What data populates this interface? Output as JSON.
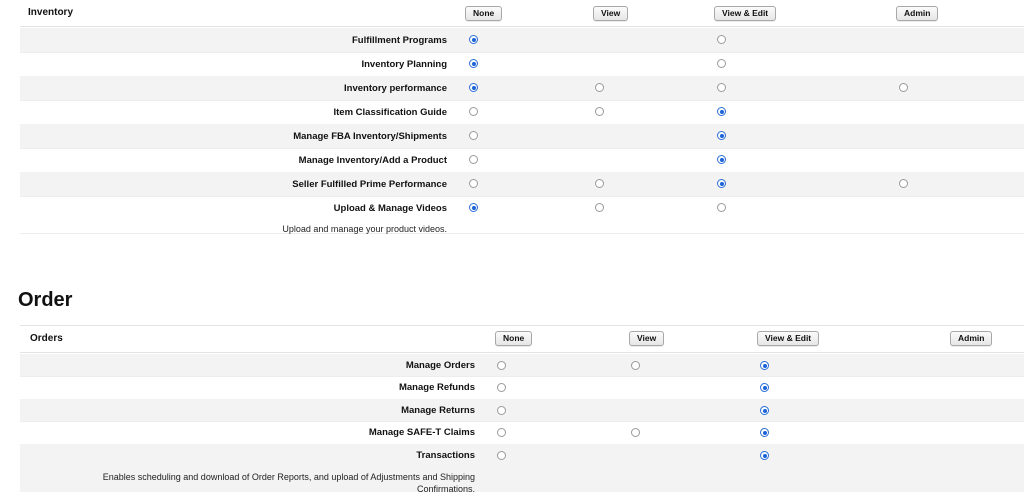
{
  "columns": [
    "None",
    "View",
    "View & Edit",
    "Admin"
  ],
  "inventory": {
    "title": "Inventory",
    "rows": [
      {
        "label": "Fulfillment Programs"
      },
      {
        "label": "Inventory Planning"
      },
      {
        "label": "Inventory performance"
      },
      {
        "label": "Item Classification Guide"
      },
      {
        "label": "Manage FBA Inventory/Shipments"
      },
      {
        "label": "Manage Inventory/Add a Product"
      },
      {
        "label": "Seller Fulfilled Prime Performance"
      },
      {
        "label": "Upload & Manage Videos",
        "description": "Upload and manage your product videos."
      }
    ]
  },
  "order": {
    "heading": "Order",
    "title": "Orders",
    "rows": [
      {
        "label": "Manage Orders"
      },
      {
        "label": "Manage Refunds"
      },
      {
        "label": "Manage Returns"
      },
      {
        "label": "Manage SAFE-T Claims"
      },
      {
        "label": "Transactions",
        "description": "Enables scheduling and download of Order Reports, and upload of Adjustments and Shipping Confirmations."
      }
    ]
  },
  "radio_states": {
    "inventory": [
      [
        "checked",
        null,
        "unchecked",
        null
      ],
      [
        "checked",
        null,
        "unchecked",
        null
      ],
      [
        "checked",
        "unchecked",
        "unchecked",
        "unchecked"
      ],
      [
        "unchecked",
        "unchecked",
        "checked",
        null
      ],
      [
        "unchecked",
        null,
        "checked",
        null
      ],
      [
        "unchecked",
        null,
        "checked",
        null
      ],
      [
        "unchecked",
        "unchecked",
        "checked",
        "unchecked"
      ],
      [
        "checked",
        "unchecked",
        "unchecked",
        null
      ]
    ],
    "order": [
      [
        "unchecked",
        "unchecked",
        "checked",
        null
      ],
      [
        "unchecked",
        null,
        "checked",
        null
      ],
      [
        "unchecked",
        null,
        "checked",
        null
      ],
      [
        "unchecked",
        "unchecked",
        "checked",
        null
      ],
      [
        "unchecked",
        null,
        "checked",
        null
      ]
    ]
  },
  "colors": {
    "radio_selected": "#1a63d8",
    "row_shade": "#f3f3f3"
  }
}
